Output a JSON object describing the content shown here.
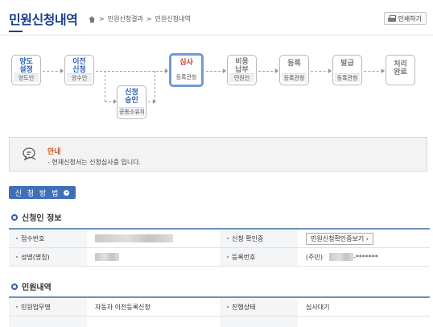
{
  "header": {
    "title": "민원신청내역",
    "breadcrumb": [
      "민원신청결과",
      "민원신청내역"
    ],
    "breadcrumb_sep": ">",
    "print_label": "인쇄하기"
  },
  "process": {
    "steps": [
      {
        "label": "양도\n설정",
        "sub": "양도인"
      },
      {
        "label": "이전\n신청",
        "sub": "양수인"
      },
      {
        "label": "신청\n승인",
        "sub": "공동소유자"
      },
      {
        "label": "심사",
        "sub": "등록관청"
      },
      {
        "label": "비용\n납부",
        "sub": "민원인"
      },
      {
        "label": "등록",
        "sub": "등록관청"
      },
      {
        "label": "발급",
        "sub": "등록관청"
      },
      {
        "label": "처리\n완료",
        "sub": ""
      }
    ]
  },
  "notice": {
    "title": "안내",
    "text": "- 현재신청서는 신청심사중 입니다."
  },
  "method_button": "신 청 방 법",
  "applicant": {
    "title": "신청인 정보",
    "rows": [
      {
        "label1": "접수번호",
        "label2": "신청 확인증",
        "button": "민원신청확인증보기 ›"
      },
      {
        "label1": "성명(명칭)",
        "label2": "등록번호",
        "reg_prefix": "(주민)",
        "reg_suffix": "-*******"
      }
    ]
  },
  "petition": {
    "title": "민원내역",
    "rows": [
      {
        "label1": "민원업무명",
        "value1": "자동차 이전등록신청",
        "label2": "진행상태",
        "value2": "심사대기"
      }
    ]
  },
  "colors": {
    "brand": "#1a3f8c",
    "accent": "#3e6fb7",
    "active_step": "#d0392b",
    "notice_title": "#d0571e"
  }
}
